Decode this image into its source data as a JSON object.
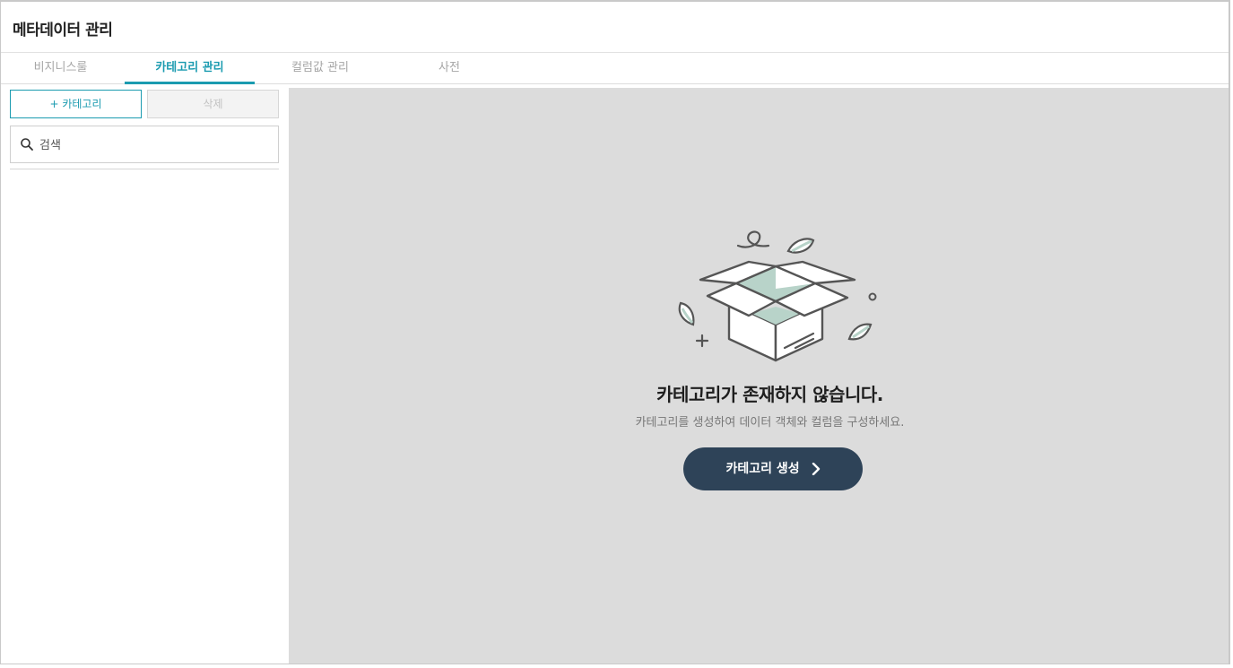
{
  "header": {
    "title": "메타데이터 관리"
  },
  "tabs": [
    {
      "label": "비지니스룰",
      "active": false
    },
    {
      "label": "카테고리 관리",
      "active": true
    },
    {
      "label": "컬럼값 관리",
      "active": false
    },
    {
      "label": "사전",
      "active": false
    }
  ],
  "sidebar": {
    "add_button_label": "+ 카테고리",
    "delete_button_label": "삭제",
    "search_placeholder": "검색",
    "search_icon": "search-icon"
  },
  "empty_state": {
    "illustration": "open-box-icon",
    "title": "카테고리가 존재하지 않습니다.",
    "description": "카테고리를 생성하여 데이터 객체와 컬럼을 구성하세요.",
    "create_button_label": "카테고리 생성",
    "create_button_icon": "chevron-right-icon"
  },
  "colors": {
    "accent": "#1b9bb0",
    "main_background": "#dcdcdc",
    "button_dark": "#2e4358",
    "box_accent": "#b8d3c9"
  }
}
